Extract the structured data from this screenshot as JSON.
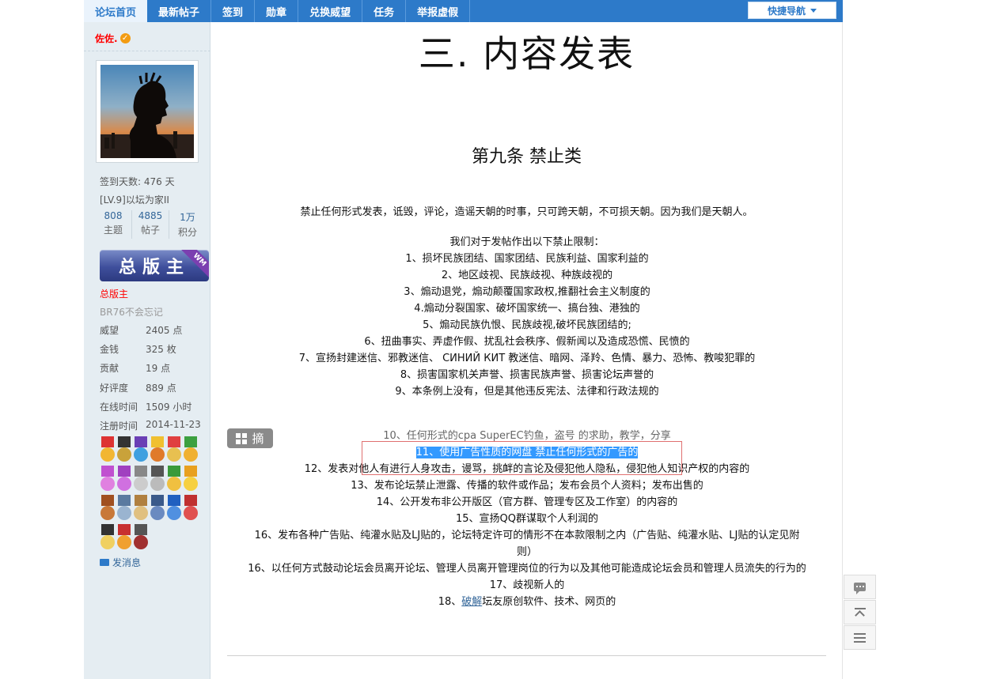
{
  "nav": {
    "tabs": [
      "论坛首页",
      "最新帖子",
      "签到",
      "勋章",
      "兑换威望",
      "任务",
      "举报虚假"
    ],
    "quick_nav": "快捷导航"
  },
  "sidebar": {
    "username": "佐佐.",
    "checkin_days": "签到天数: 476 天",
    "level": "[LV.9]以坛为家II",
    "stats": [
      {
        "num": "808",
        "label": "主题"
      },
      {
        "num": "4885",
        "label": "帖子"
      },
      {
        "num": "1万",
        "label": "积分"
      }
    ],
    "badge_text": "总版主",
    "badge_tag": "WM",
    "group": "总版主",
    "custom_title": "BR76不会忘记",
    "props": [
      {
        "k": "威望",
        "v": "2405 点"
      },
      {
        "k": "金钱",
        "v": "325 枚"
      },
      {
        "k": "贡献",
        "v": "19 点"
      },
      {
        "k": "好评度",
        "v": "889 点"
      },
      {
        "k": "在线时间",
        "v": "1509 小时"
      },
      {
        "k": "注册时间",
        "v": "2014-11-23"
      }
    ],
    "send_message": "发消息"
  },
  "post": {
    "big_title": "三. 内容发表",
    "sub_title": "第九条 禁止类",
    "intro": "禁止任何形式发表，诋毁，评论，造谣天朝的时事，只可跨天朝，不可损天朝。因为我们是天朝人。",
    "restrict_header": "我们对于发帖作出以下禁止限制：",
    "rules_a": [
      "1、损坏民族团结、国家团结、民族利益、国家利益的",
      "2、地区歧视、民族歧视、种族歧视的",
      "3、煽动退党，煽动颠覆国家政权,推翻社会主义制度的",
      "4.煽动分裂国家、破坏国家统一、搞台独、港独的",
      "5、煽动民族仇恨、民族歧视,破坏民族团结的;",
      "6、扭曲事实、弄虚作假、扰乱社会秩序、假新闻以及造成恐慌、民愤的",
      "7、宣扬封建迷信、邪教迷信、 СИНИЙ КИТ 教迷信、暗网、泽羚、色情、暴力、恐怖、教唆犯罪的",
      "8、损害国家机关声誉、损害民族声誉、损害论坛声誉的",
      "9、本条例上没有，但是其他违反宪法、法律和行政法规的"
    ],
    "rule_10": "10、任何形式的cpa SuperEC钓鱼，盗号 的求助，教学，分享",
    "rule_11": "11、使用广告性质的网盘 禁止任何形式的广告的",
    "rules_b": [
      "12、发表对他人有进行人身攻击，谩骂，挑衅的言论及侵犯他人隐私，侵犯他人知识产权的内容的",
      "13、发布论坛禁止泄露、传播的软件或作品；发布会员个人资料；发布出售的",
      "14、公开发布非公开版区（官方群、管理专区及工作室）的内容的",
      "15、宣扬QQ群谋取个人利润的",
      "16、发布各种广告贴、纯灌水贴及LJ贴的，论坛特定许可的情形不在本款限制之内（广告贴、纯灌水贴、LJ贴的认定见附",
      "则）",
      "16、以任何方式鼓动论坛会员离开论坛、管理人员离开管理岗位的行为以及其他可能造成论坛会员和管理人员流失的行为的",
      "17、歧视新人的"
    ],
    "rule_18_pre": "18、",
    "rule_18_link": "破解",
    "rule_18_post": "坛友原创软件、技术、网页的",
    "excerpt_label": "摘"
  }
}
